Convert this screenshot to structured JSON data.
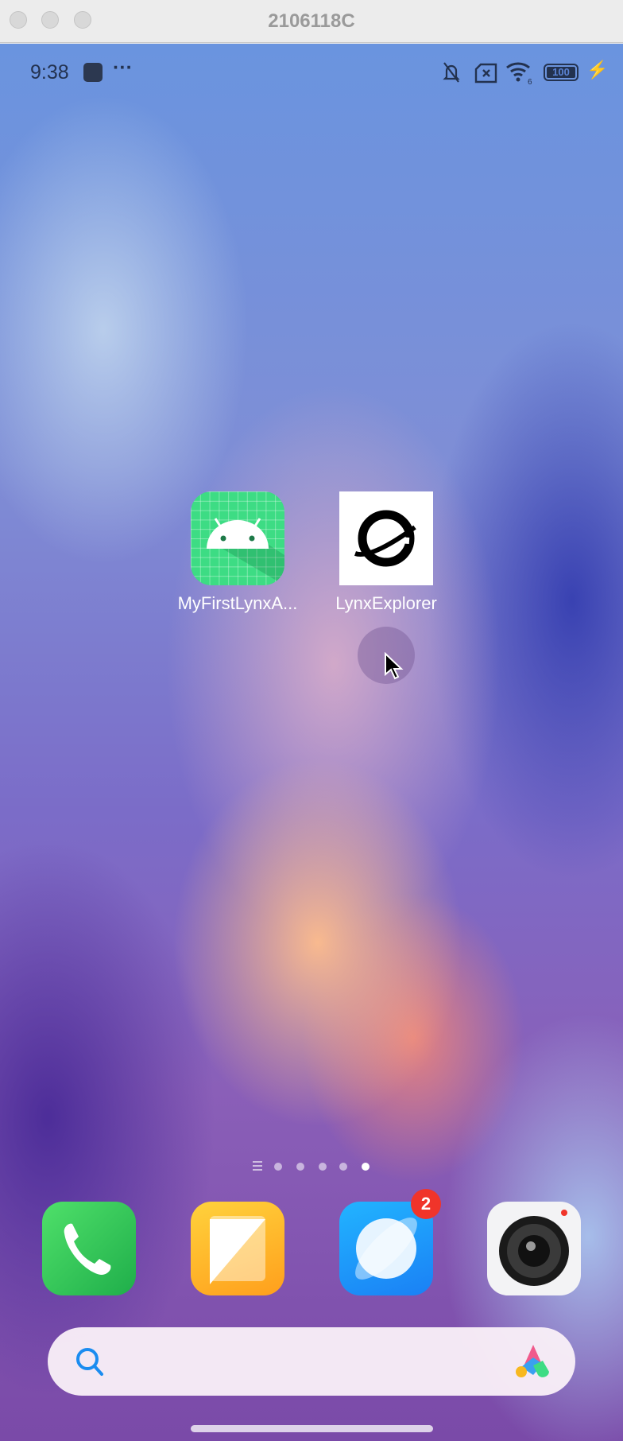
{
  "window": {
    "title": "2106118C"
  },
  "status_bar": {
    "time": "9:38",
    "battery": "100",
    "wifi_label": "6",
    "icons": [
      "app-notification-icon",
      "more-icon",
      "mute-icon",
      "no-sim-icon",
      "wifi-icon",
      "battery-icon",
      "charging-icon"
    ]
  },
  "home": {
    "apps": [
      {
        "label": "MyFirstLynxA...",
        "icon": "android-icon"
      },
      {
        "label": "LynxExplorer",
        "icon": "lynx-explorer-icon"
      }
    ]
  },
  "page_indicator": {
    "pages": 5,
    "current": 5
  },
  "dock": {
    "apps": [
      {
        "name": "phone",
        "icon": "phone-icon"
      },
      {
        "name": "notes",
        "icon": "notes-icon"
      },
      {
        "name": "browser",
        "icon": "browser-icon",
        "badge": "2"
      },
      {
        "name": "camera",
        "icon": "camera-icon"
      }
    ]
  },
  "search": {
    "icon": "search-icon",
    "assistant_icon": "assistant-icon"
  },
  "colors": {
    "badge": "#f0342a",
    "android_bg": "#3ddc84"
  }
}
